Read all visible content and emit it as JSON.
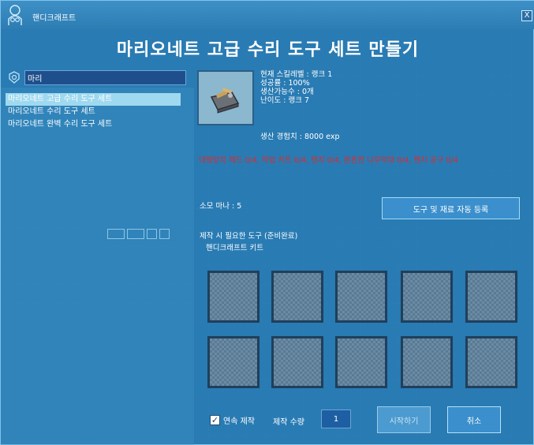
{
  "window": {
    "title": "핸디크래프트",
    "close_label": "X",
    "app_icon": "handicraft-icon"
  },
  "recipe_title": "마리오네트 고급 수리 도구 세트 만들기",
  "search": {
    "value": "마리",
    "icon": "search-icon"
  },
  "recipes": [
    {
      "label": "마리오네트 고급 수리 도구 세트",
      "selected": true
    },
    {
      "label": "마리오네트 수리 도구 세트",
      "selected": false
    },
    {
      "label": "마리오네트 완벽 수리 도구 세트",
      "selected": false
    }
  ],
  "info": {
    "skill_level": "현재 스킬레벨 : 랭크 1",
    "success_rate": "성공률 : 100%",
    "craftable": "생산가능수 : 0개",
    "difficulty": "난이도 : 랭크 7",
    "exp": "생산 경험치 : 8000 exp"
  },
  "materials": "대형망치 헤드 0/4, 작업 키트 0/4, 렌치 0/4, 튼튼한 나무막대 0/4, 펜치 공구 0/4",
  "mana": "소모 마나 : 5",
  "auto_register_label": "도구 및 재료 자동 등록",
  "tools": {
    "label": "제작 시 필요한 도구 (준비완료)",
    "item": "핸디크래프트 키트"
  },
  "slot_count": 10,
  "continuous": {
    "label": "연속 제작",
    "checked": true,
    "check_glyph": "✓"
  },
  "quantity": {
    "label": "제작 수량",
    "value": "1"
  },
  "buttons": {
    "start": "시작하기",
    "cancel": "취소"
  },
  "colors": {
    "materials_text": "#e02a2a",
    "selected_row": "#9fd9ef",
    "window_bg": "#2678b0"
  }
}
